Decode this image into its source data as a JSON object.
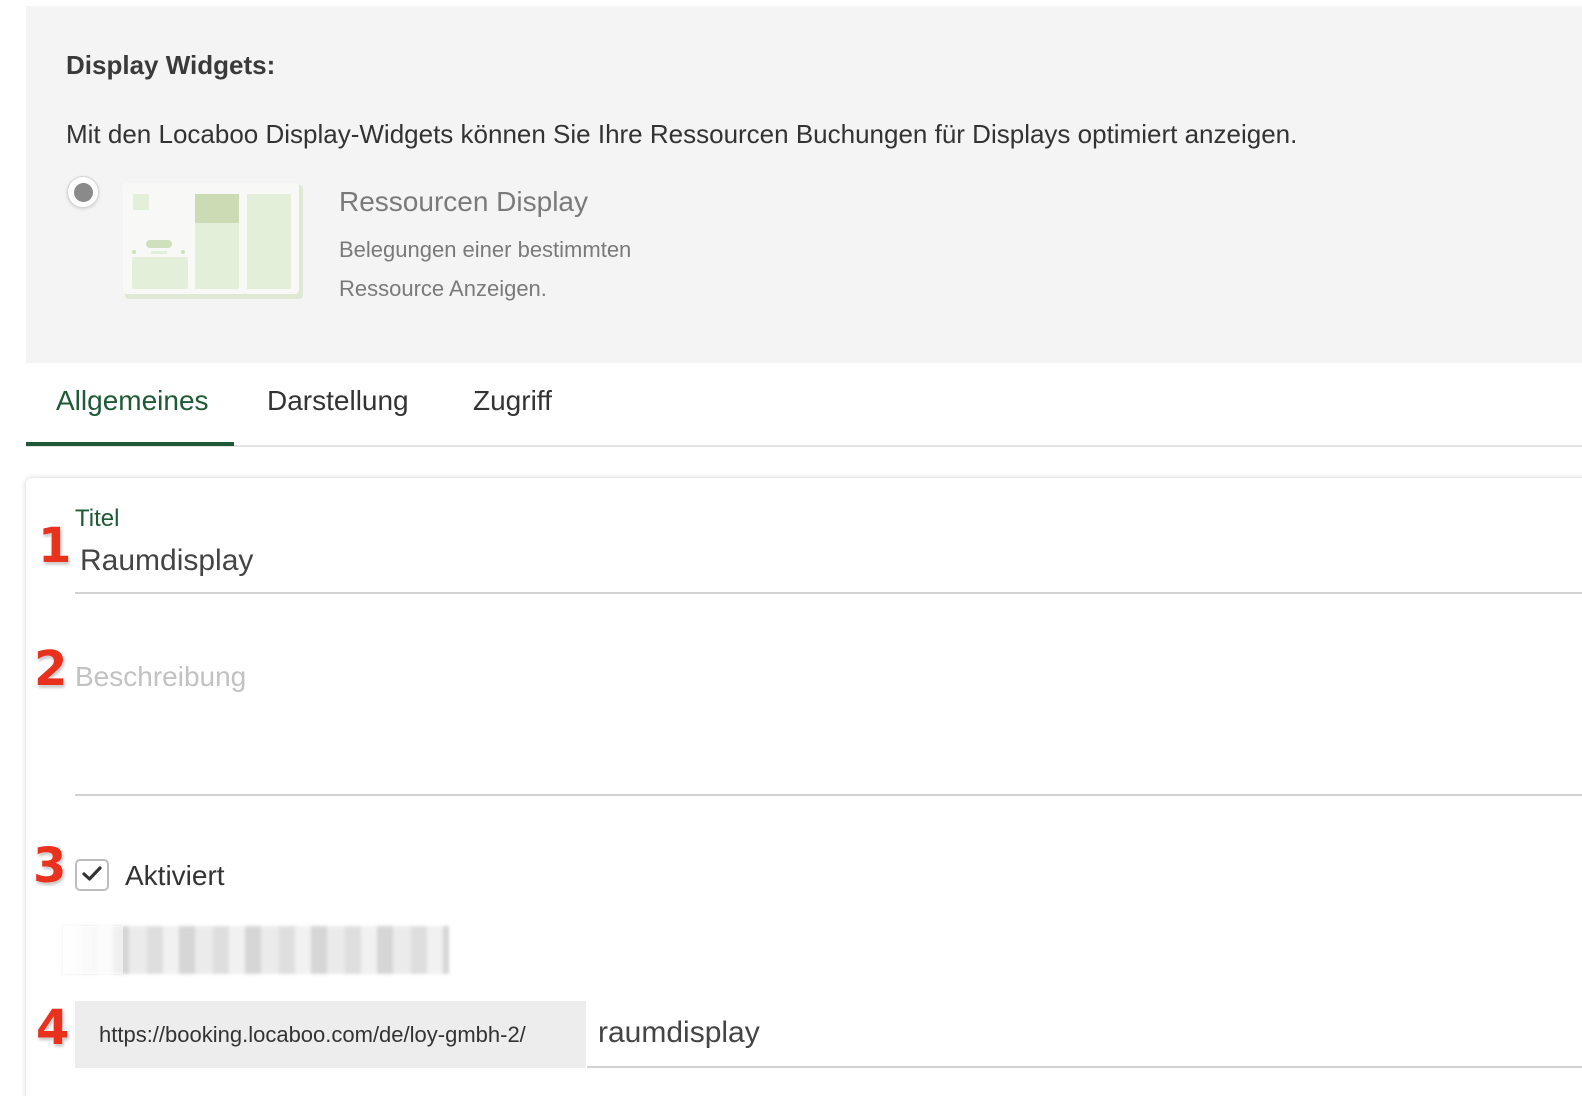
{
  "widgets": {
    "heading": "Display Widgets:",
    "description": "Mit den Locaboo Display-Widgets können Sie Ihre Ressourcen Buchungen für Displays optimiert anzeigen.",
    "options": [
      {
        "title": "Ressourcen Display",
        "description": "Belegungen einer bestimmten Ressource Anzeigen.",
        "selected": true
      }
    ]
  },
  "tabs": [
    {
      "label": "Allgemeines",
      "active": true
    },
    {
      "label": "Darstellung",
      "active": false
    },
    {
      "label": "Zugriff",
      "active": false
    }
  ],
  "form": {
    "title_label": "Titel",
    "title_value": "Raumdisplay",
    "description_placeholder": "Beschreibung",
    "activated_label": "Aktiviert",
    "activated": true,
    "url_prefix": "https://booking.locaboo.com/de/loy-gmbh-2/",
    "url_slug": "raumdisplay"
  },
  "annotations": [
    "1",
    "2",
    "3",
    "4"
  ],
  "colors": {
    "accent": "#1d5a35",
    "panel_bg": "#f4f4f4",
    "badge": "#e8321e"
  }
}
